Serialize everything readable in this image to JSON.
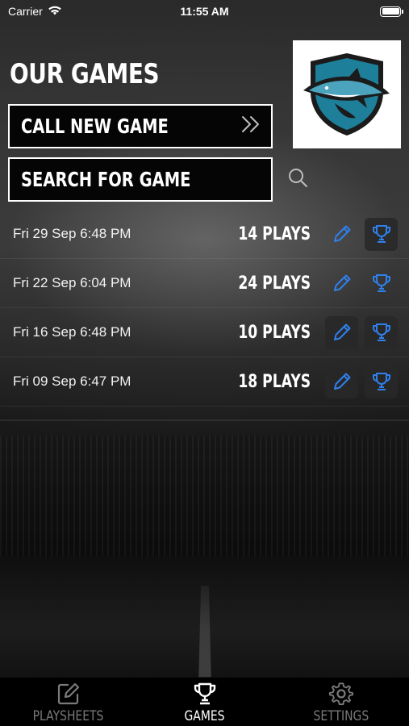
{
  "status_bar": {
    "carrier": "Carrier",
    "time": "11:55 AM"
  },
  "header": {
    "title": "OUR GAMES",
    "logo_icon": "shark-shield-logo"
  },
  "actions": {
    "call_new_label": "CALL NEW GAME",
    "call_new_icon": "double-chevron-right-icon",
    "search_placeholder": "SEARCH FOR GAME",
    "search_icon": "search-icon"
  },
  "games": [
    {
      "date": "Fri 29 Sep 6:48 PM",
      "plays": "14 PLAYS"
    },
    {
      "date": "Fri 22 Sep 6:04 PM",
      "plays": "24 PLAYS"
    },
    {
      "date": "Fri 16 Sep 6:48 PM",
      "plays": "10 PLAYS"
    },
    {
      "date": "Fri 09 Sep 6:47 PM",
      "plays": "18 PLAYS"
    }
  ],
  "tabs": [
    {
      "label": "PLAYSHEETS",
      "icon": "edit-icon",
      "active": false
    },
    {
      "label": "GAMES",
      "icon": "trophy-icon",
      "active": true
    },
    {
      "label": "SETTINGS",
      "icon": "gear-icon",
      "active": false
    }
  ],
  "colors": {
    "accent": "#2f80ed",
    "background": "#0c0c0c",
    "text": "#ffffff",
    "inactive_tab": "#7a7a7a"
  }
}
